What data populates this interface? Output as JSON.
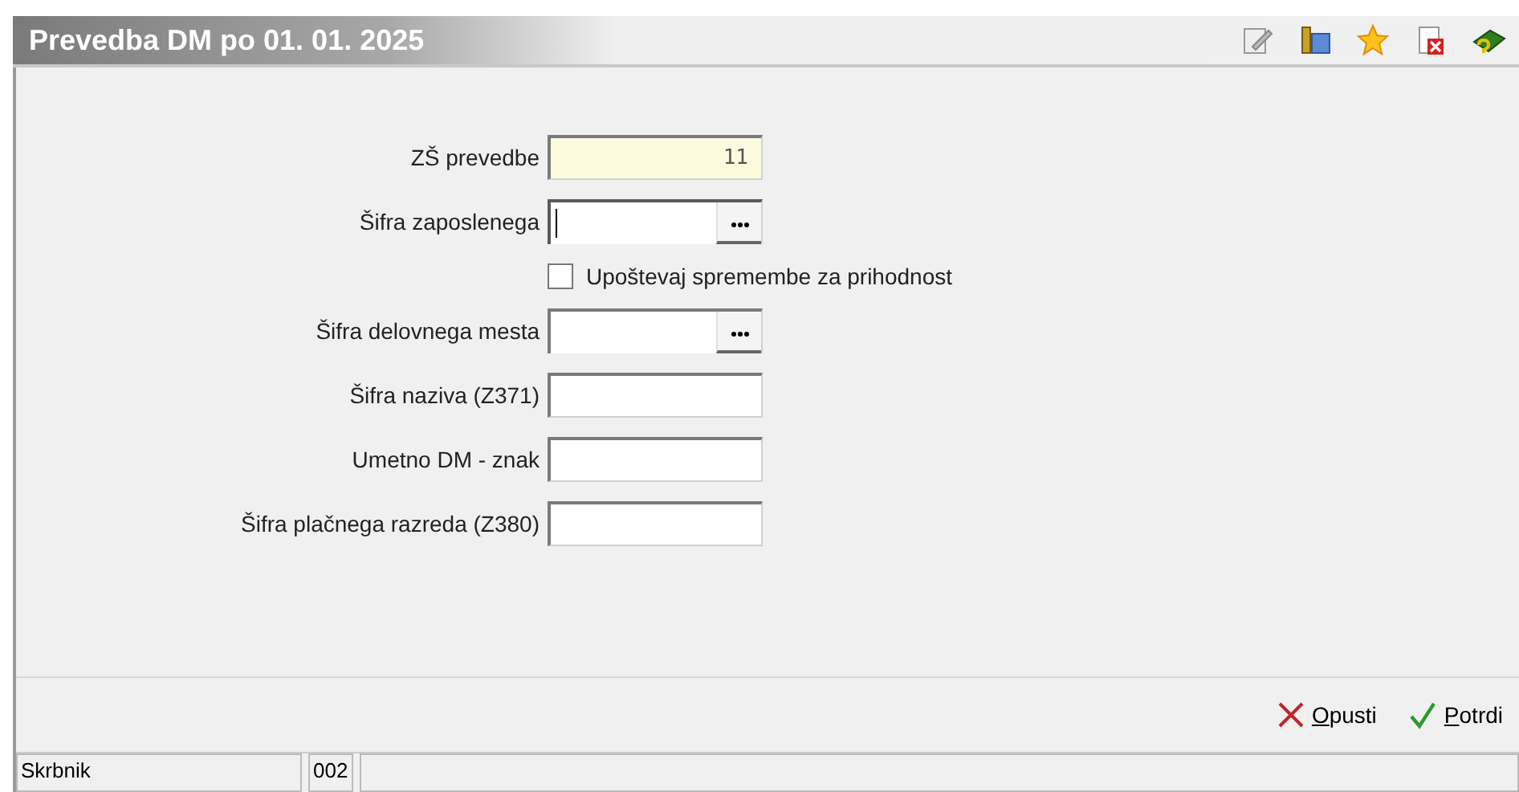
{
  "window": {
    "title": "Prevedba DM po 01. 01. 2025"
  },
  "fields": [
    {
      "kind": "readonly",
      "label": "ZŠ prevedbe",
      "value": "11"
    },
    {
      "kind": "lookup",
      "label": "Šifra zaposlenega",
      "focused": true
    },
    {
      "kind": "checkbox",
      "label": "Upoštevaj spremembe za prihodnost",
      "checked": false
    },
    {
      "kind": "lookup",
      "label": "Šifra delovnega mesta",
      "focused": false
    },
    {
      "kind": "text",
      "label": "Šifra naziva (Z371)"
    },
    {
      "kind": "text",
      "label": "Umetno DM - znak"
    },
    {
      "kind": "text",
      "label": "Šifra plačnega razreda (Z380)"
    }
  ],
  "buttons": [
    {
      "kind": "cancel",
      "label": "Opusti"
    },
    {
      "kind": "confirm",
      "label": "Potrdi"
    }
  ],
  "status_bar": {
    "user": "Skrbnik",
    "code": "002"
  }
}
